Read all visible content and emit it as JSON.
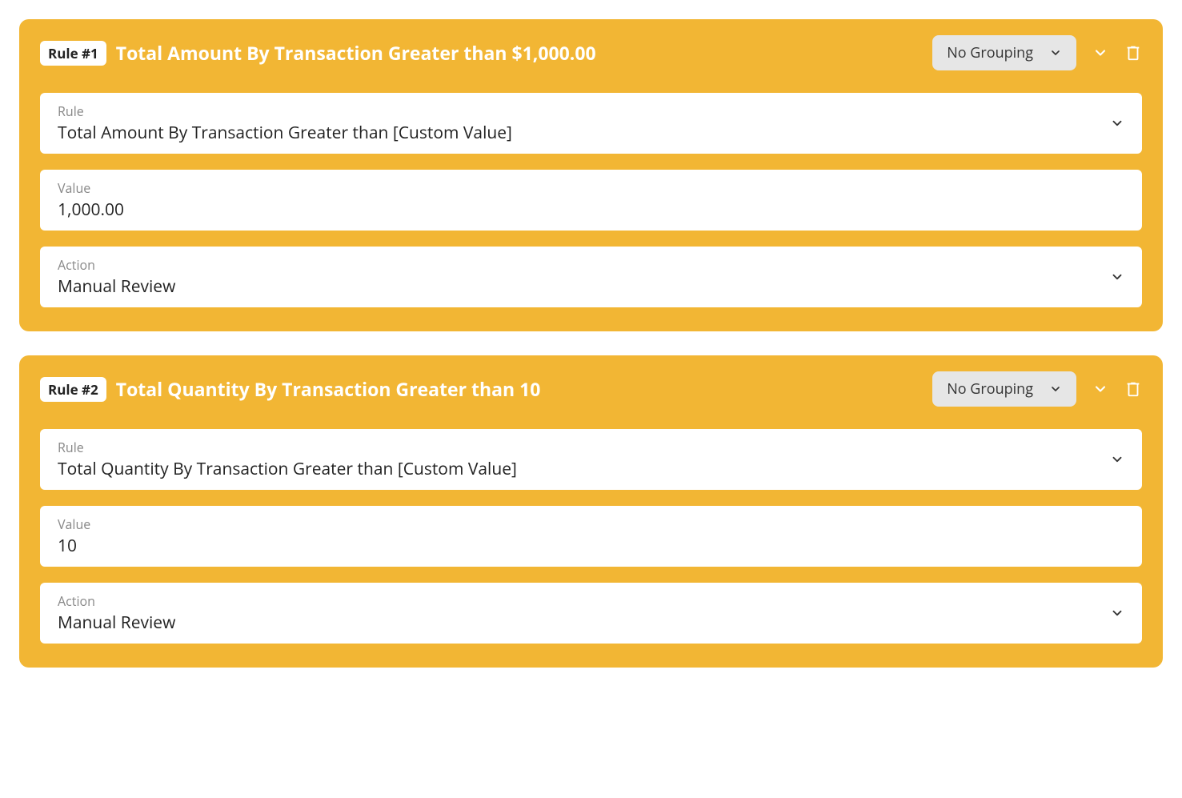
{
  "labels": {
    "rule": "Rule",
    "value": "Value",
    "action": "Action"
  },
  "rules": [
    {
      "badge": "Rule #1",
      "title": "Total Amount By Transaction Greater than $1,000.00",
      "grouping": "No Grouping",
      "rule_select": "Total Amount By Transaction Greater than [Custom Value]",
      "value": "1,000.00",
      "action": "Manual Review"
    },
    {
      "badge": "Rule #2",
      "title": "Total Quantity By Transaction Greater than 10",
      "grouping": "No Grouping",
      "rule_select": "Total Quantity By Transaction Greater than [Custom Value]",
      "value": "10",
      "action": "Manual Review"
    }
  ]
}
